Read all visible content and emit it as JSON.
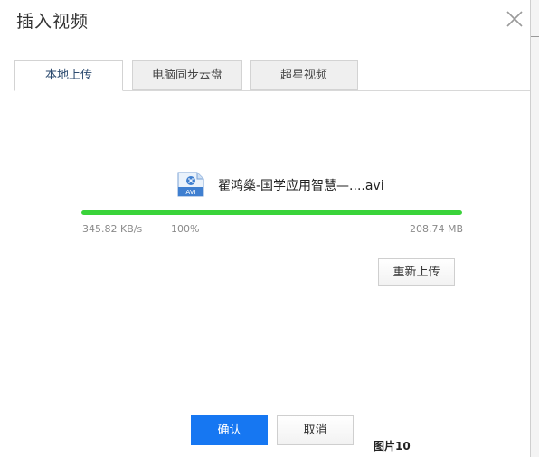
{
  "dialog": {
    "title": "插入视频",
    "close_icon": "close-icon"
  },
  "tabs": [
    {
      "label": "本地上传",
      "active": true
    },
    {
      "label": "电脑同步云盘",
      "active": false
    },
    {
      "label": "超星视频",
      "active": false
    }
  ],
  "upload": {
    "file_icon": "avi-file-icon",
    "file_icon_text": "AVI",
    "file_name": "翟鸿燊-国学应用智慧—....avi",
    "speed": "345.82 KB/s",
    "percent_text": "100%",
    "progress": 1.0,
    "size": "208.74 MB",
    "progress_color": "#3ad33a",
    "reupload_label": "重新上传"
  },
  "footer": {
    "confirm_label": "确认",
    "cancel_label": "取消",
    "confirm_color": "#1677f2"
  },
  "caption": "图片10"
}
